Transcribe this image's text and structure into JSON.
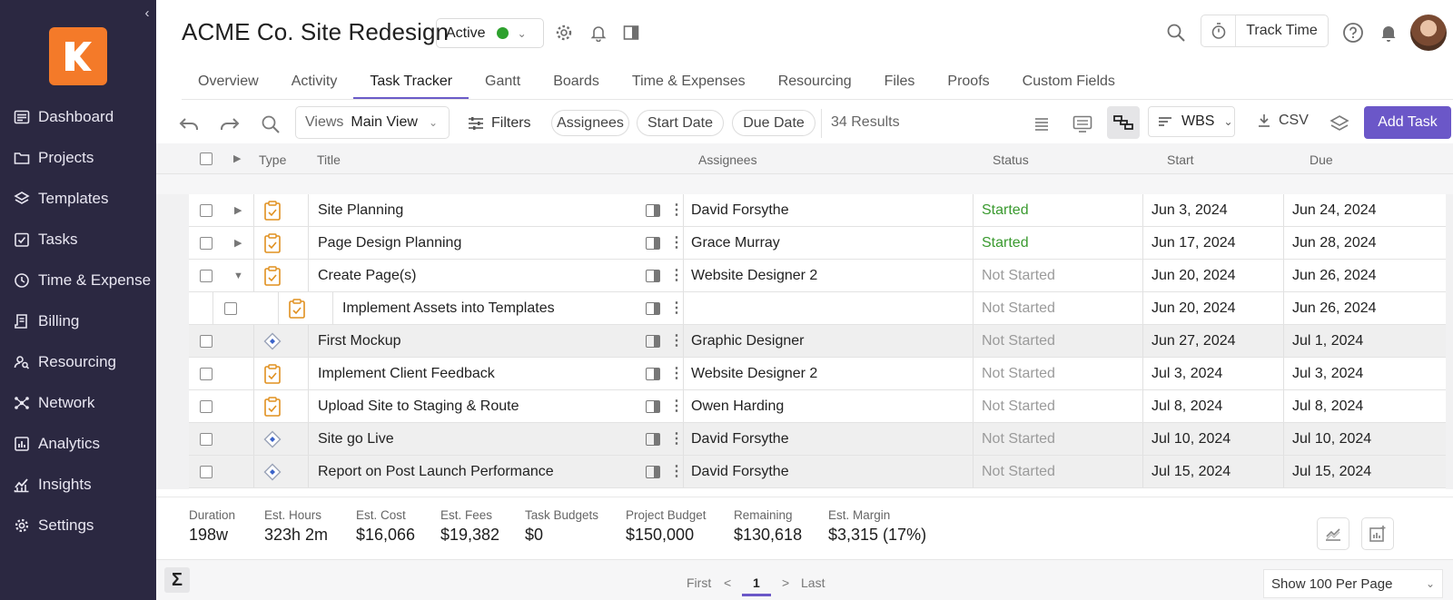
{
  "sidebar": {
    "items": [
      {
        "label": "Dashboard",
        "icon": "dashboard-icon"
      },
      {
        "label": "Projects",
        "icon": "folder-icon"
      },
      {
        "label": "Templates",
        "icon": "layers-icon"
      },
      {
        "label": "Tasks",
        "icon": "task-check-icon"
      },
      {
        "label": "Time & Expense",
        "icon": "clock-icon"
      },
      {
        "label": "Billing",
        "icon": "invoice-icon"
      },
      {
        "label": "Resourcing",
        "icon": "user-search-icon"
      },
      {
        "label": "Network",
        "icon": "network-icon"
      },
      {
        "label": "Analytics",
        "icon": "bar-chart-icon"
      },
      {
        "label": "Insights",
        "icon": "trend-icon"
      },
      {
        "label": "Settings",
        "icon": "gear-icon"
      }
    ]
  },
  "header": {
    "title": "ACME Co. Site Redesign",
    "status": "Active",
    "status_color": "#2ea12e",
    "track_time": "Track Time"
  },
  "tabs": [
    {
      "label": "Overview"
    },
    {
      "label": "Activity"
    },
    {
      "label": "Task Tracker",
      "active": true
    },
    {
      "label": "Gantt"
    },
    {
      "label": "Boards"
    },
    {
      "label": "Time & Expenses"
    },
    {
      "label": "Resourcing"
    },
    {
      "label": "Files"
    },
    {
      "label": "Proofs"
    },
    {
      "label": "Custom Fields"
    }
  ],
  "toolbar": {
    "views_label": "Views",
    "views_value": "Main View",
    "filters": "Filters",
    "pill_assignees": "Assignees",
    "pill_start": "Start Date",
    "pill_due": "Due Date",
    "results": "34 Results",
    "wbs": "WBS",
    "csv": "CSV",
    "add_task": "Add Task",
    "accent": "#6b57c8"
  },
  "table": {
    "headers": {
      "type": "Type",
      "title": "Title",
      "assignees": "Assignees",
      "status": "Status",
      "start": "Start",
      "due": "Due"
    },
    "rows": [
      {
        "title": "Site Planning",
        "assignee": "David Forsythe",
        "status": "Started",
        "start": "Jun 3, 2024",
        "due": "Jun 24, 2024",
        "type": "task",
        "expand": "collapsed"
      },
      {
        "title": "Page Design Planning",
        "assignee": "Grace Murray",
        "status": "Started",
        "start": "Jun 17, 2024",
        "due": "Jun 28, 2024",
        "type": "task",
        "expand": "collapsed"
      },
      {
        "title": "Create Page(s)",
        "assignee": "Website Designer 2",
        "status": "Not Started",
        "start": "Jun 20, 2024",
        "due": "Jun 26, 2024",
        "type": "task",
        "expand": "expanded"
      },
      {
        "title": "Implement Assets into Templates",
        "assignee": "",
        "status": "Not Started",
        "start": "Jun 20, 2024",
        "due": "Jun 26, 2024",
        "type": "task",
        "indent": true
      },
      {
        "title": "First Mockup",
        "assignee": "Graphic Designer",
        "status": "Not Started",
        "start": "Jun 27, 2024",
        "due": "Jul 1, 2024",
        "type": "milestone",
        "shaded": true
      },
      {
        "title": "Implement Client Feedback",
        "assignee": "Website Designer 2",
        "status": "Not Started",
        "start": "Jul 3, 2024",
        "due": "Jul 3, 2024",
        "type": "task"
      },
      {
        "title": "Upload Site to Staging & Route",
        "assignee": "Owen Harding",
        "status": "Not Started",
        "start": "Jul 8, 2024",
        "due": "Jul 8, 2024",
        "type": "task"
      },
      {
        "title": "Site go Live",
        "assignee": "David Forsythe",
        "status": "Not Started",
        "start": "Jul 10, 2024",
        "due": "Jul 10, 2024",
        "type": "milestone",
        "shaded": true
      },
      {
        "title": "Report on Post Launch Performance",
        "assignee": "David Forsythe",
        "status": "Not Started",
        "start": "Jul 15, 2024",
        "due": "Jul 15, 2024",
        "type": "milestone",
        "shaded": true
      }
    ]
  },
  "summary": [
    {
      "label": "Duration",
      "value": "198w"
    },
    {
      "label": "Est. Hours",
      "value": "323h 2m"
    },
    {
      "label": "Est. Cost",
      "value": "$16,066"
    },
    {
      "label": "Est. Fees",
      "value": "$19,382"
    },
    {
      "label": "Task Budgets",
      "value": "$0"
    },
    {
      "label": "Project Budget",
      "value": "$150,000"
    },
    {
      "label": "Remaining",
      "value": "$130,618"
    },
    {
      "label": "Est. Margin",
      "value": "$3,315 (17%)"
    }
  ],
  "pagination": {
    "first": "First",
    "prev": "<",
    "current": "1",
    "next": ">",
    "last": "Last",
    "per_page": "Show 100 Per Page"
  }
}
